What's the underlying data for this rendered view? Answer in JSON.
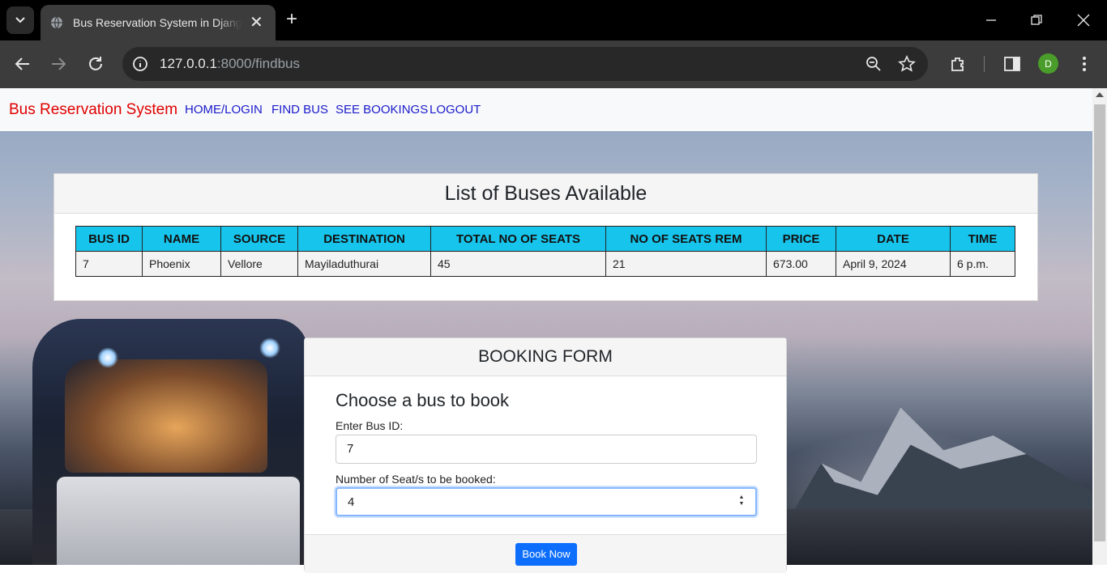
{
  "browser": {
    "tab_title": "Bus Reservation System in Django",
    "url_host": "127.0.0.1",
    "url_rest": ":8000/findbus",
    "profile_initial": "D"
  },
  "navbar": {
    "brand": "Bus Reservation System",
    "links": [
      "HOME/LOGIN",
      "FIND BUS",
      "SEE BOOKINGS",
      "LOGOUT"
    ]
  },
  "bus_list": {
    "title": "List of Buses Available",
    "columns": [
      "BUS ID",
      "NAME",
      "SOURCE",
      "DESTINATION",
      "TOTAL NO OF SEATS",
      "NO OF SEATS REM",
      "PRICE",
      "DATE",
      "TIME"
    ],
    "rows": [
      [
        "7",
        "Phoenix",
        "Vellore",
        "Mayiladuthurai",
        "45",
        "21",
        "673.00",
        "April 9, 2024",
        "6 p.m."
      ]
    ]
  },
  "booking_form": {
    "title": "BOOKING FORM",
    "heading": "Choose a bus to book",
    "bus_id_label": "Enter Bus ID:",
    "bus_id_value": "7",
    "seats_label": "Number of Seat/s to be booked:",
    "seats_value": "4",
    "submit_label": "Book Now"
  }
}
